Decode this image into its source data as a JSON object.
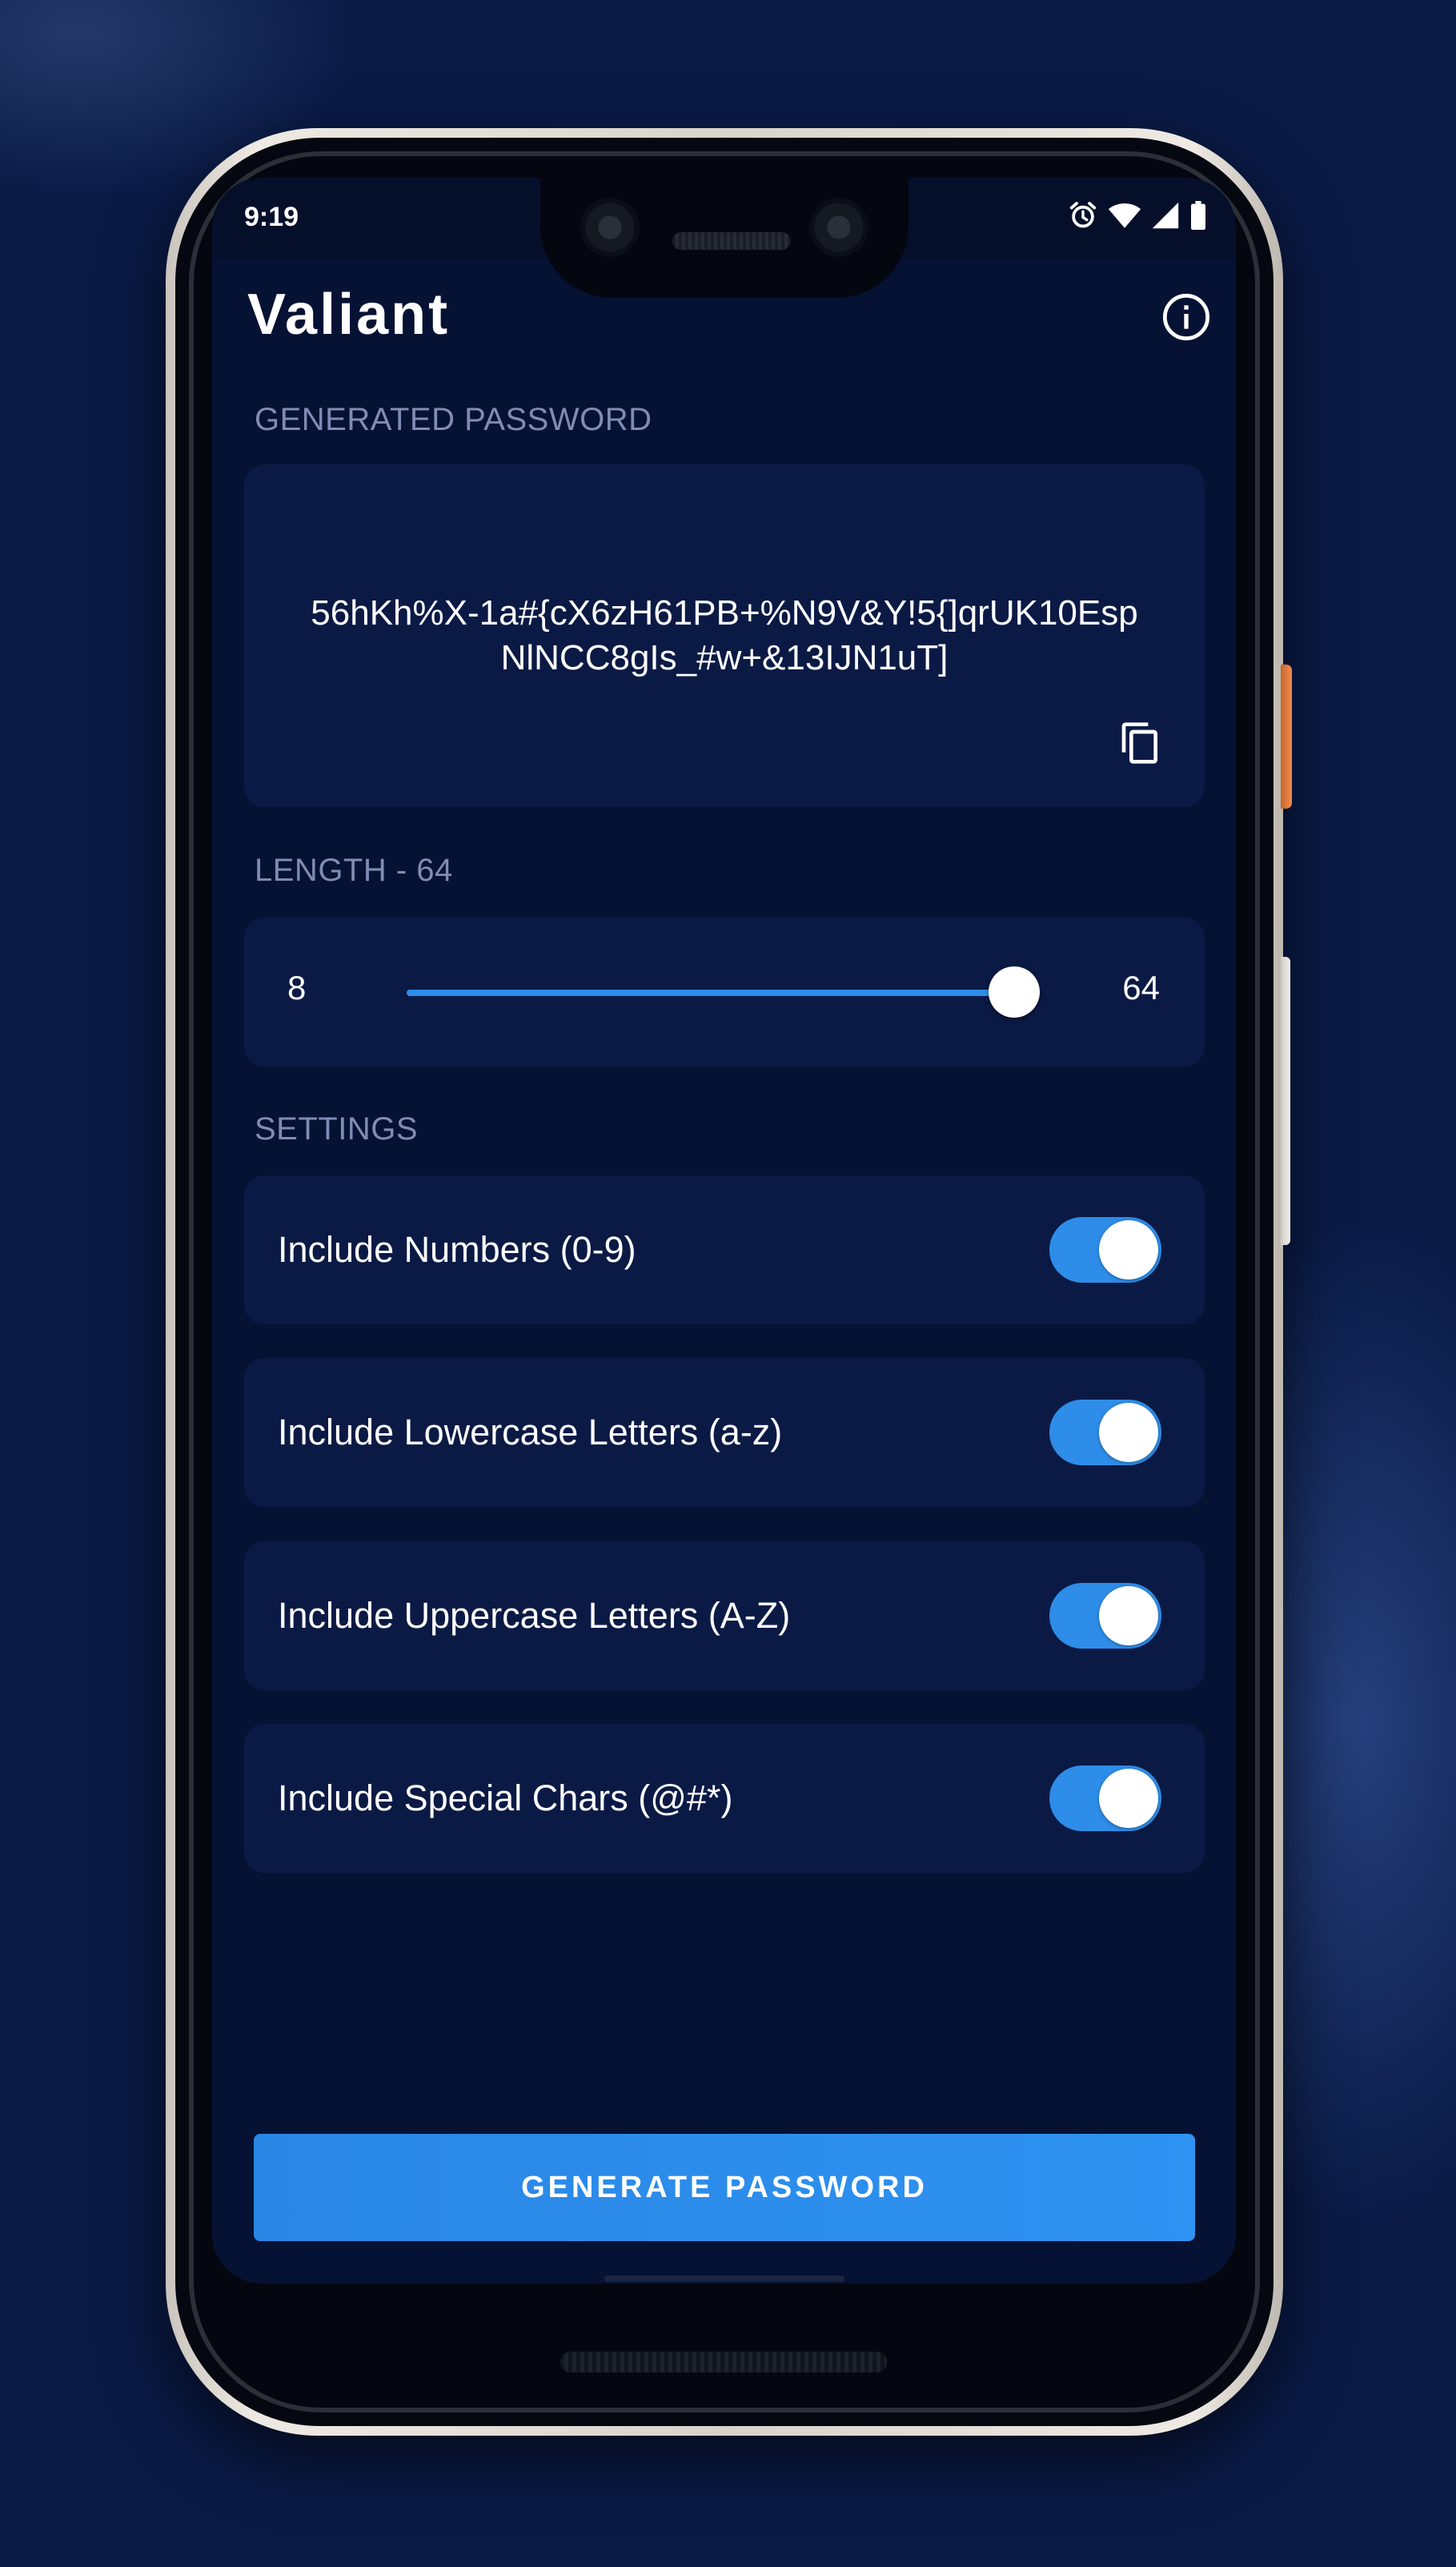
{
  "status_bar": {
    "time": "9:19",
    "icons": [
      "alarm-icon",
      "wifi-icon",
      "signal-icon",
      "battery-icon"
    ]
  },
  "app": {
    "title": "Valiant",
    "info_icon": "info-icon"
  },
  "password_section": {
    "label": "GENERATED PASSWORD",
    "value": "56hKh%X-1a#{cX6zH61PB+%N9V&Y!5{]qrUK10EspNlNCC8gIs_#w+&13IJN1uT]",
    "copy_icon": "copy-icon"
  },
  "length_section": {
    "label": "LENGTH - 64",
    "min": "8",
    "max": "64",
    "value": 64
  },
  "settings_section": {
    "label": "SETTINGS",
    "items": [
      {
        "label": "Include Numbers (0-9)",
        "enabled": true
      },
      {
        "label": "Include Lowercase Letters (a-z)",
        "enabled": true
      },
      {
        "label": "Include Uppercase Letters (A-Z)",
        "enabled": true
      },
      {
        "label": "Include Special Chars (@#*)",
        "enabled": true
      }
    ]
  },
  "actions": {
    "generate_label": "GENERATE PASSWORD"
  },
  "colors": {
    "background": "#0a1a45",
    "screen": "#061233",
    "card": "#0b1a45",
    "accent": "#2e8de8",
    "label": "#7f8cb4"
  }
}
